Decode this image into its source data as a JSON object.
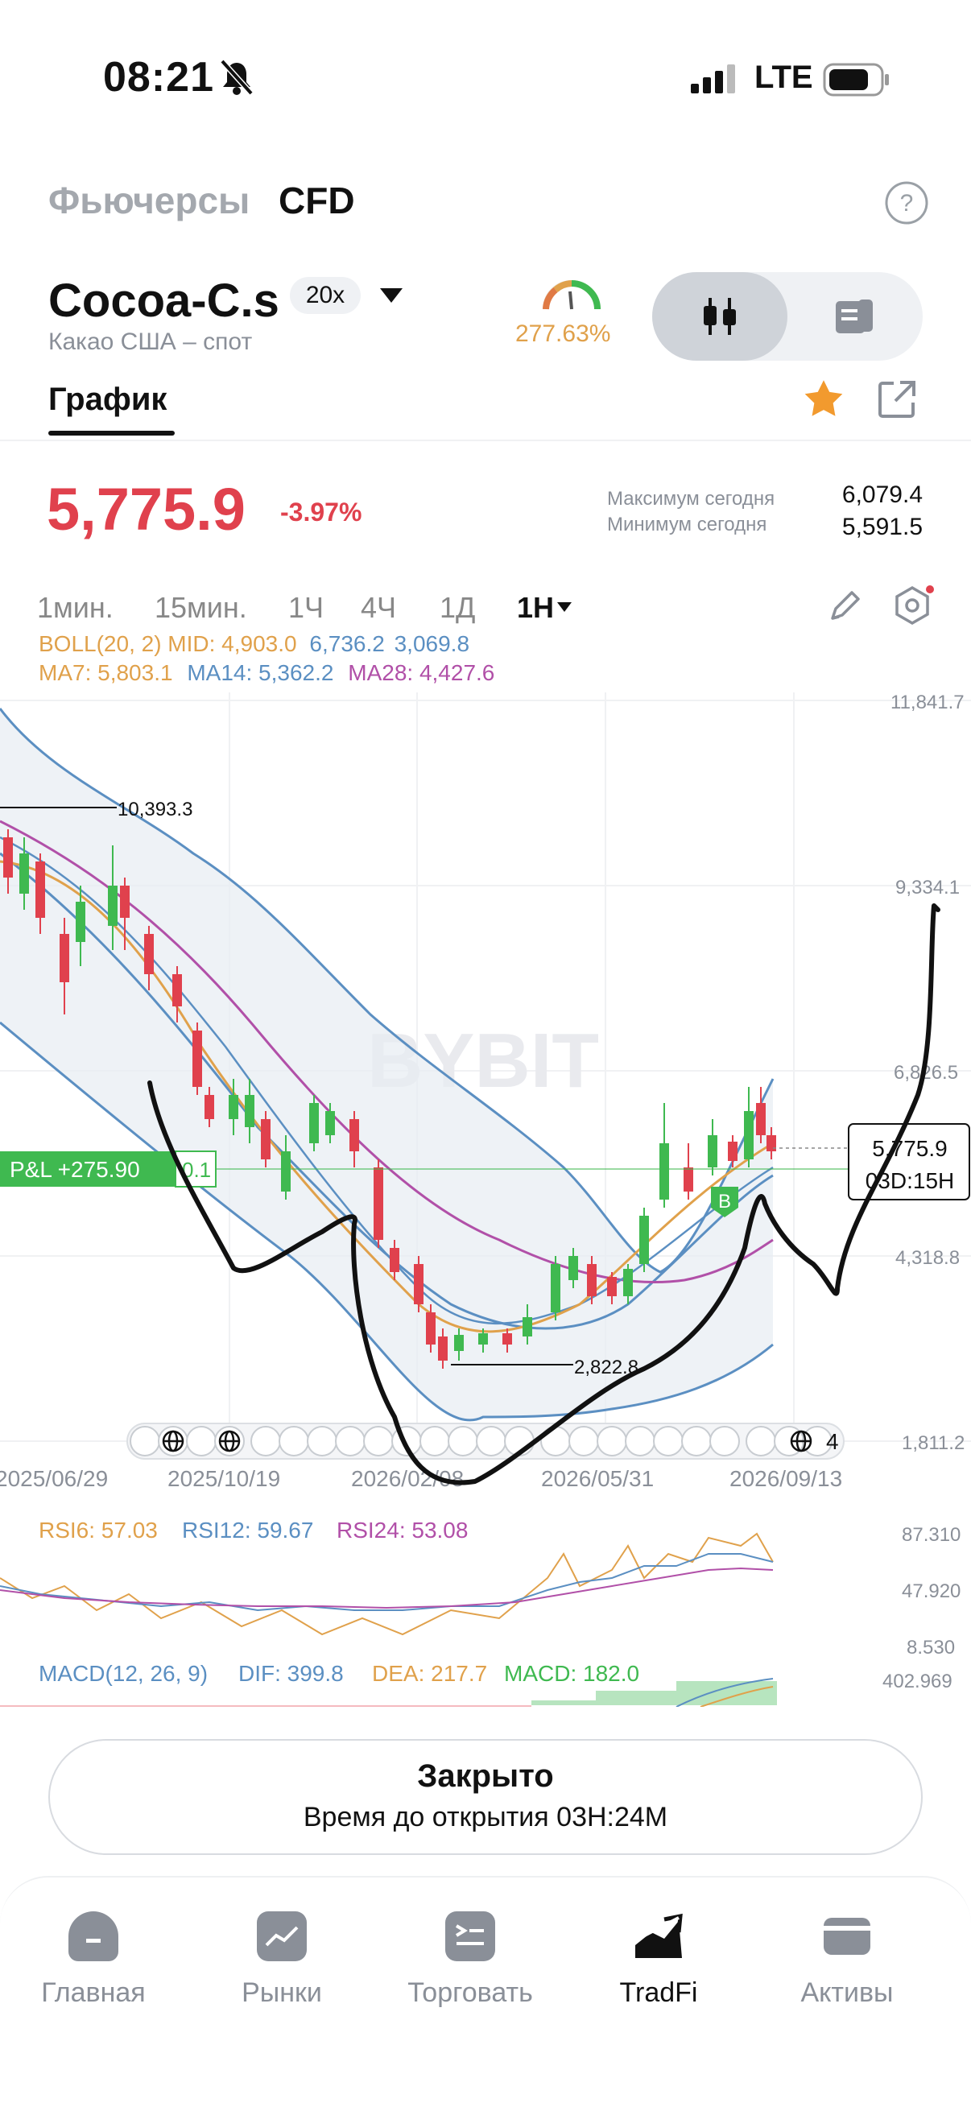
{
  "status": {
    "time": "08:21",
    "network": "LTE"
  },
  "top_tabs": {
    "futures": "Фьючерсы",
    "cfd": "CFD"
  },
  "instrument": {
    "symbol": "Cocoa-C.s",
    "leverage": "20x",
    "subtitle": "Какао США – спот",
    "gauge_value": "277.63%",
    "chart_tab": "График",
    "last_price": "5,775.9",
    "change": "-3.97%",
    "high_label": "Максимум сегодня",
    "high_value": "6,079.4",
    "low_label": "Минимум сегодня",
    "low_value": "5,591.5"
  },
  "timeframes": [
    "1мин.",
    "15мин.",
    "1Ч",
    "4Ч",
    "1Д",
    "1Н"
  ],
  "selected_timeframe": "1Н",
  "indicators": {
    "boll": "BOLL(20, 2) MID: 4,903.0",
    "boll_up": "6,736.2",
    "boll_dn": "3,069.8",
    "ma7": "MA7: 5,803.1",
    "ma14": "MA14: 5,362.2",
    "ma28": "MA28: 4,427.6",
    "rsi6": "RSI6: 57.03",
    "rsi12": "RSI12: 59.67",
    "rsi24": "RSI24: 53.08",
    "macd": "MACD(12, 26, 9)",
    "dif": "DIF: 399.8",
    "dea": "DEA: 217.7",
    "macd_val": "MACD: 182.0"
  },
  "colors": {
    "up": "#3fb950",
    "down": "#e0414d",
    "gauge": "#e0a14b",
    "star": "#f29a2e"
  },
  "chart": {
    "y_ticks": [
      "11,841.7",
      "9,334.1",
      "6,826.5",
      "4,318.8",
      "1,811.2"
    ],
    "x_ticks": [
      "2025/06/29",
      "2025/10/19",
      "2026/02/08",
      "2026/05/31",
      "2026/09/13"
    ],
    "high_marker": "10,393.3",
    "low_marker": "2,822.8",
    "pnl": "P&L +275.90",
    "pnl_tail": "0.1",
    "price_tag": "5,775.9",
    "countdown": "03D:15H",
    "buy_marker": "B",
    "event_count": "4",
    "watermark": "BYBIT",
    "rsi_ticks": [
      "87.310",
      "47.920",
      "8.530"
    ],
    "macd_tick": "402.969"
  },
  "closed_panel": {
    "title": "Закрыто",
    "subtitle": "Время до открытия 03H:24M"
  },
  "nav": [
    {
      "label": "Главная",
      "icon": "home-icon"
    },
    {
      "label": "Рынки",
      "icon": "markets-icon"
    },
    {
      "label": "Торговать",
      "icon": "trade-icon"
    },
    {
      "label": "TradFi",
      "icon": "tradfi-icon"
    },
    {
      "label": "Активы",
      "icon": "wallet-icon"
    }
  ],
  "chart_data": {
    "type": "candlestick",
    "x": [
      "2025/06/29",
      "2025/10/19",
      "2026/02/08",
      "2026/05/31",
      "2026/09/13"
    ],
    "ylim": [
      1811.2,
      11841.7
    ],
    "last": 5775.9,
    "marked_high": 10393.3,
    "marked_low": 2822.8
  }
}
